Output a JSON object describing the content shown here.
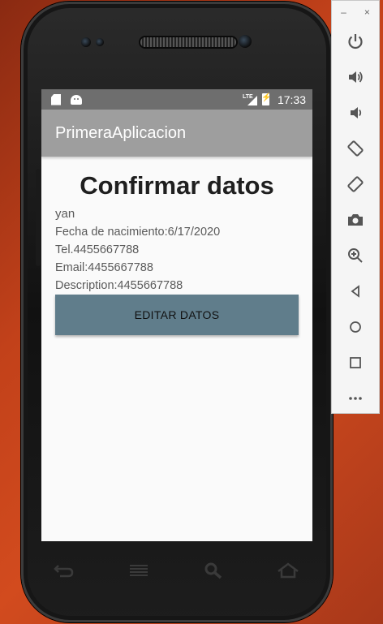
{
  "status_bar": {
    "time": "17:33",
    "icons": [
      "sd-card-icon",
      "android-icon",
      "lte-signal-icon",
      "battery-charging-icon"
    ]
  },
  "app_bar": {
    "title": "PrimeraAplicacion"
  },
  "main": {
    "heading": "Confirmar datos",
    "name": "yan",
    "birth_date": "Fecha de nacimiento:6/17/2020",
    "phone": "Tel.4455667788",
    "email": "Email:4455667788",
    "description": "Description:4455667788",
    "edit_button": "EDITAR DATOS"
  },
  "hardware_keys": [
    "back-icon",
    "menu-icon",
    "search-icon",
    "home-icon"
  ],
  "emulator_toolbar": {
    "window_controls": {
      "minimize": "–",
      "close": "×"
    },
    "buttons": [
      "power-icon",
      "volume-up-icon",
      "volume-down-icon",
      "rotate-left-icon",
      "rotate-right-icon",
      "camera-icon",
      "zoom-icon",
      "back-triangle-icon",
      "home-circle-icon",
      "overview-square-icon",
      "more-icon"
    ]
  },
  "colors": {
    "app_bar": "#9e9e9e",
    "status_bar": "#6e6e6e",
    "button": "#607d8b",
    "background": "#fafafa"
  }
}
